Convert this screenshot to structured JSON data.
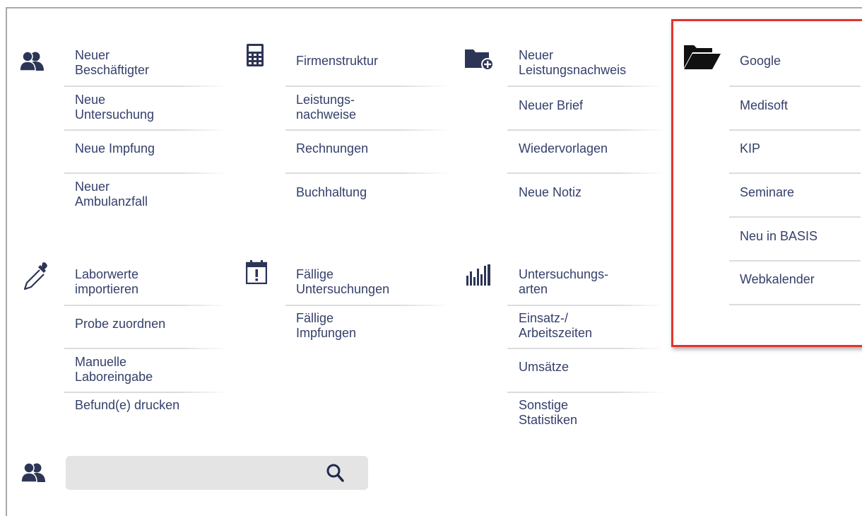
{
  "colors": {
    "text": "#35406b",
    "icon": "#2d3556",
    "highlight": "#e2342f",
    "search_bg": "#e4e4e4"
  },
  "sections": {
    "staff": {
      "icon": "users-icon",
      "items": [
        "Neuer\nBeschäftigter",
        "Neue\nUntersuchung",
        "Neue Impfung",
        "Neuer\nAmbulanzfall"
      ]
    },
    "company": {
      "icon": "calculator-icon",
      "items": [
        "Firmenstruktur",
        "Leistungs-\nnachweise",
        "Rechnungen",
        "Buchhaltung"
      ]
    },
    "documents": {
      "icon": "folder-add-icon",
      "items": [
        "Neuer\nLeistungsnachweis",
        "Neuer Brief",
        "Wiedervorlagen",
        "Neue Notiz"
      ]
    },
    "links": {
      "icon": "folder-open-icon",
      "items": [
        "Google",
        "Medisoft",
        "KIP",
        "Seminare",
        "Neu in BASIS",
        "Webkalender"
      ]
    },
    "lab": {
      "icon": "pipette-icon",
      "items": [
        "Laborwerte\nimportieren",
        "Probe zuordnen",
        "Manuelle\nLaboreingabe",
        "Befund(e) drucken"
      ]
    },
    "due": {
      "icon": "calendar-alert-icon",
      "items": [
        "Fällige\nUntersuchungen",
        "Fällige\nImpfungen"
      ]
    },
    "stats": {
      "icon": "bar-chart-icon",
      "items": [
        "Untersuchungs-\narten",
        "Einsatz-/\nArbeitszeiten",
        "Umsätze",
        "Sonstige\nStatistiken"
      ]
    }
  },
  "search": {
    "icon": "search-icon",
    "user_icon": "users-icon",
    "placeholder": "",
    "value": ""
  }
}
